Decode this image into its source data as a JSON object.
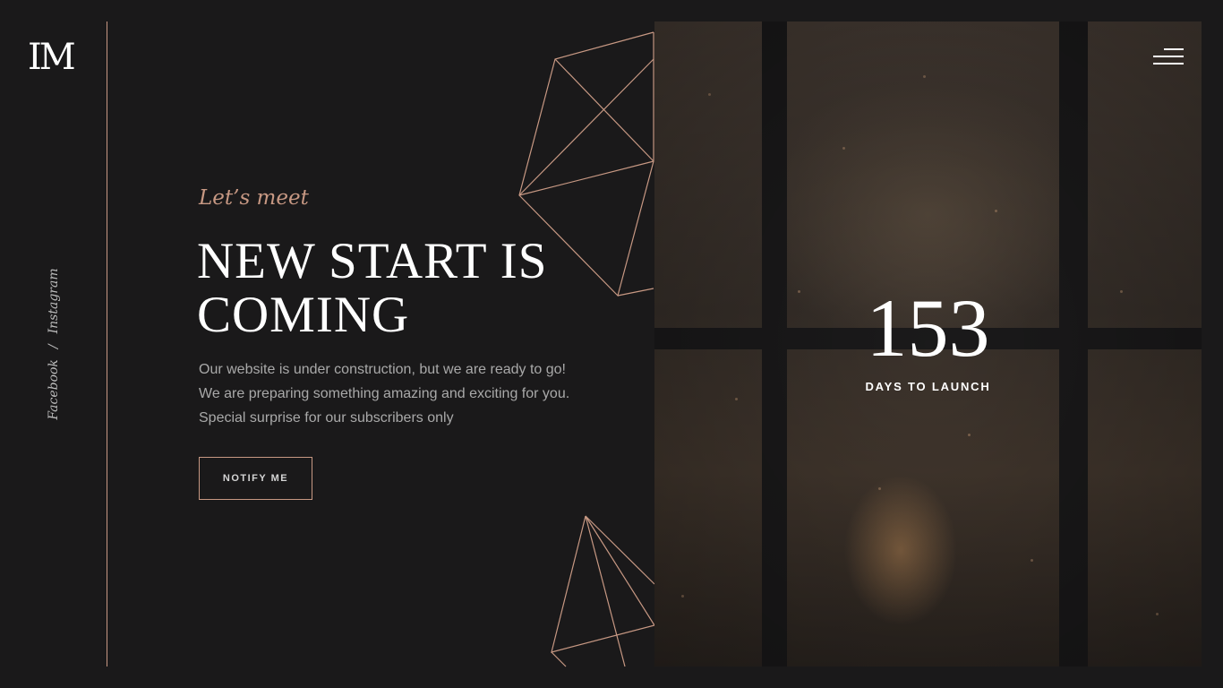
{
  "brand": {
    "logo_text": "IM"
  },
  "social": {
    "facebook": "Facebook",
    "separator": "/",
    "instagram": "Instagram"
  },
  "hero": {
    "eyebrow": "Let’s meet",
    "headline_line1": "NEW START IS",
    "headline_line2": "COMING",
    "description": "Our website is under construction, but we are ready to go! We are preparing something amazing and exciting for you. Special surprise for our subscribers only",
    "cta_label": "NOTIFY ME"
  },
  "countdown": {
    "value": "153",
    "label": "DAYS TO LAUNCH"
  },
  "icons": {
    "menu": "hamburger-menu-icon"
  },
  "colors": {
    "accent": "#c79883",
    "background": "#1a191a",
    "text": "#ffffff",
    "muted": "#a9a9a9"
  }
}
